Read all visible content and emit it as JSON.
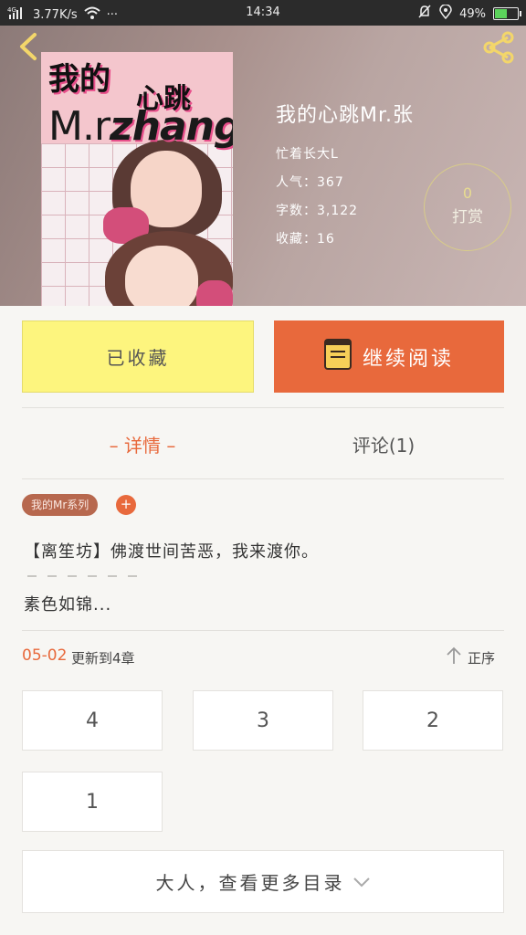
{
  "status_bar": {
    "network": "4G",
    "speed": "3.77K/s",
    "more": "···",
    "time": "14:34",
    "battery": "49%",
    "battery_level": 0.49
  },
  "book": {
    "cover": {
      "line1": "我的",
      "line2": "心跳",
      "line3_a": "M.r",
      "line3_b": "zhang"
    },
    "title": "我的心跳Mr.张",
    "author": "忙着长大L",
    "popularity": "人气：367",
    "word_count": "字数：3,122",
    "favorites": "收藏：16"
  },
  "reward": {
    "count": "0",
    "label": "打赏"
  },
  "buttons": {
    "collected": "已收藏",
    "continue_reading": "继续阅读"
  },
  "tabs": {
    "details": "– 详情 –",
    "comments": "评论(1)"
  },
  "tag": {
    "label": "我的Mr系列",
    "add": "+"
  },
  "intro": {
    "line1": "【离笙坊】佛渡世间苦恶，我来渡你。",
    "line2": "素色如锦..."
  },
  "update": {
    "date": "05-02",
    "text": "更新到4章",
    "sort_label": "正序"
  },
  "chapters": [
    "4",
    "3",
    "2",
    "1"
  ],
  "more_button": "大人，查看更多目录",
  "colors": {
    "accent": "#e8693c",
    "collected_bg": "#fdf57e"
  }
}
